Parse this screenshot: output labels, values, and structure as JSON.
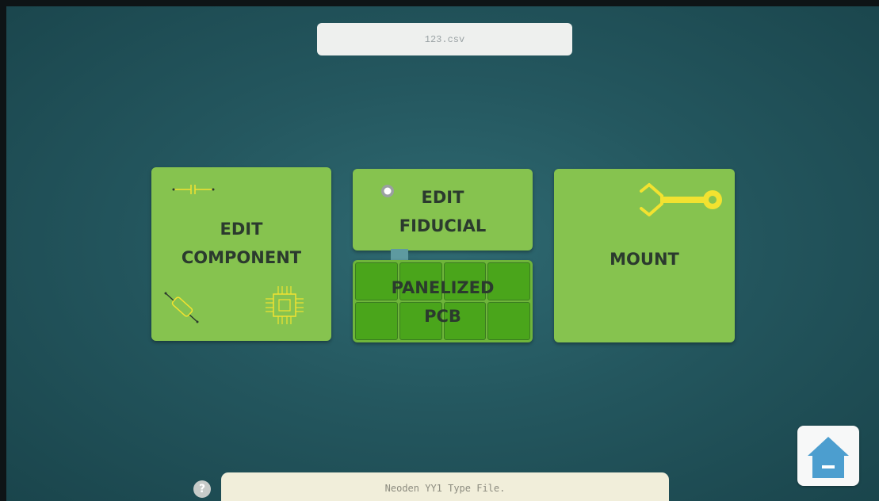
{
  "file_name": "123.csv",
  "cards": {
    "edit_component": {
      "line1": "EDIT",
      "line2": "COMPONENT"
    },
    "edit_fiducial": {
      "line1": "EDIT",
      "line2": "FIDUCIAL"
    },
    "panelized_pcb": {
      "line1": "PANELIZED",
      "line2": "PCB"
    },
    "mount": {
      "label": "MOUNT"
    }
  },
  "status_text": "Neoden YY1 Type File.",
  "help_label": "?",
  "colors": {
    "card": "#86c34f",
    "panel_cell": "#4aa51b",
    "icon_yellow": "#f2e230",
    "home_icon": "#4c9ecf"
  },
  "icons": {
    "capacitor": "capacitor-icon",
    "resistor": "resistor-icon",
    "chip": "chip-icon",
    "fiducial": "fiducial-icon",
    "nozzle": "nozzle-gripper-icon",
    "home": "home-icon"
  }
}
